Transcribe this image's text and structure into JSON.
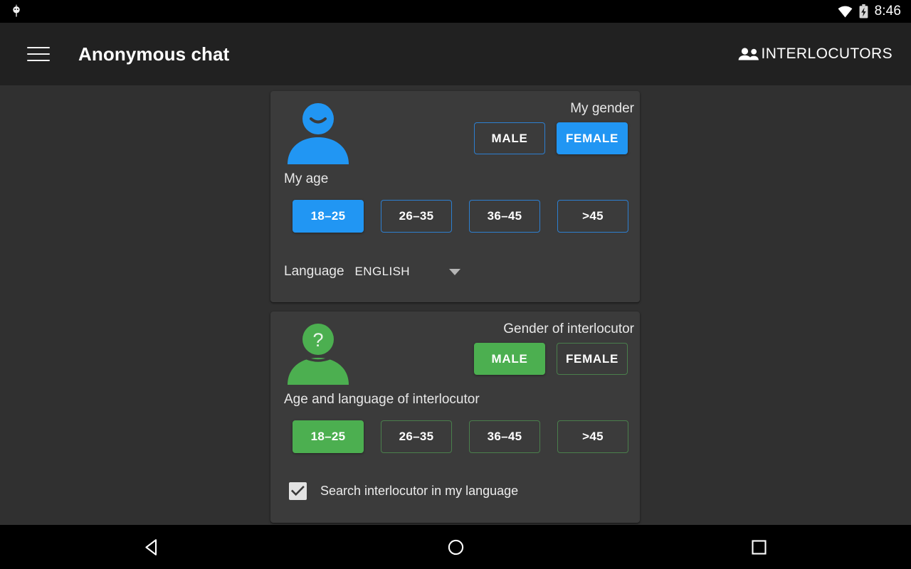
{
  "status_bar": {
    "notification_icon": "android-bug-icon",
    "wifi_icon": "wifi-icon",
    "battery_icon": "battery-charging-icon",
    "clock": "8:46"
  },
  "app_bar": {
    "menu_icon": "hamburger-menu-icon",
    "title": "Anonymous chat",
    "action_icon": "people-icon",
    "action_label": "INTERLOCUTORS"
  },
  "colors": {
    "accent_self": "#2196f3",
    "accent_other": "#4caf50",
    "card_background": "#3b3b3b",
    "page_background": "#303030",
    "app_bar_background": "#212121"
  },
  "self_card": {
    "avatar_icon": "person-smiling-avatar-icon",
    "gender_label": "My gender",
    "gender_options": [
      {
        "label": "MALE",
        "selected": false
      },
      {
        "label": "FEMALE",
        "selected": true
      }
    ],
    "age_label": "My age",
    "age_options": [
      {
        "label": "18–25",
        "selected": true
      },
      {
        "label": "26–35",
        "selected": false
      },
      {
        "label": "36–45",
        "selected": false
      },
      {
        "label": ">45",
        "selected": false
      }
    ],
    "language_title": "Language",
    "language_value": "ENGLISH",
    "language_caret_icon": "chevron-down-icon"
  },
  "other_card": {
    "avatar_icon": "person-question-avatar-icon",
    "gender_label": "Gender of interlocutor",
    "gender_options": [
      {
        "label": "MALE",
        "selected": true
      },
      {
        "label": "FEMALE",
        "selected": false
      }
    ],
    "age_label": "Age and language of interlocutor",
    "age_options": [
      {
        "label": "18–25",
        "selected": true
      },
      {
        "label": "26–35",
        "selected": false
      },
      {
        "label": "36–45",
        "selected": false
      },
      {
        "label": ">45",
        "selected": false
      }
    ],
    "checkbox_label": "Search interlocutor in my language",
    "checkbox_checked": true,
    "checkbox_icon": "checkmark-icon"
  },
  "nav_bar": {
    "back_icon": "back-triangle-icon",
    "home_icon": "home-circle-icon",
    "recents_icon": "recents-square-icon"
  }
}
